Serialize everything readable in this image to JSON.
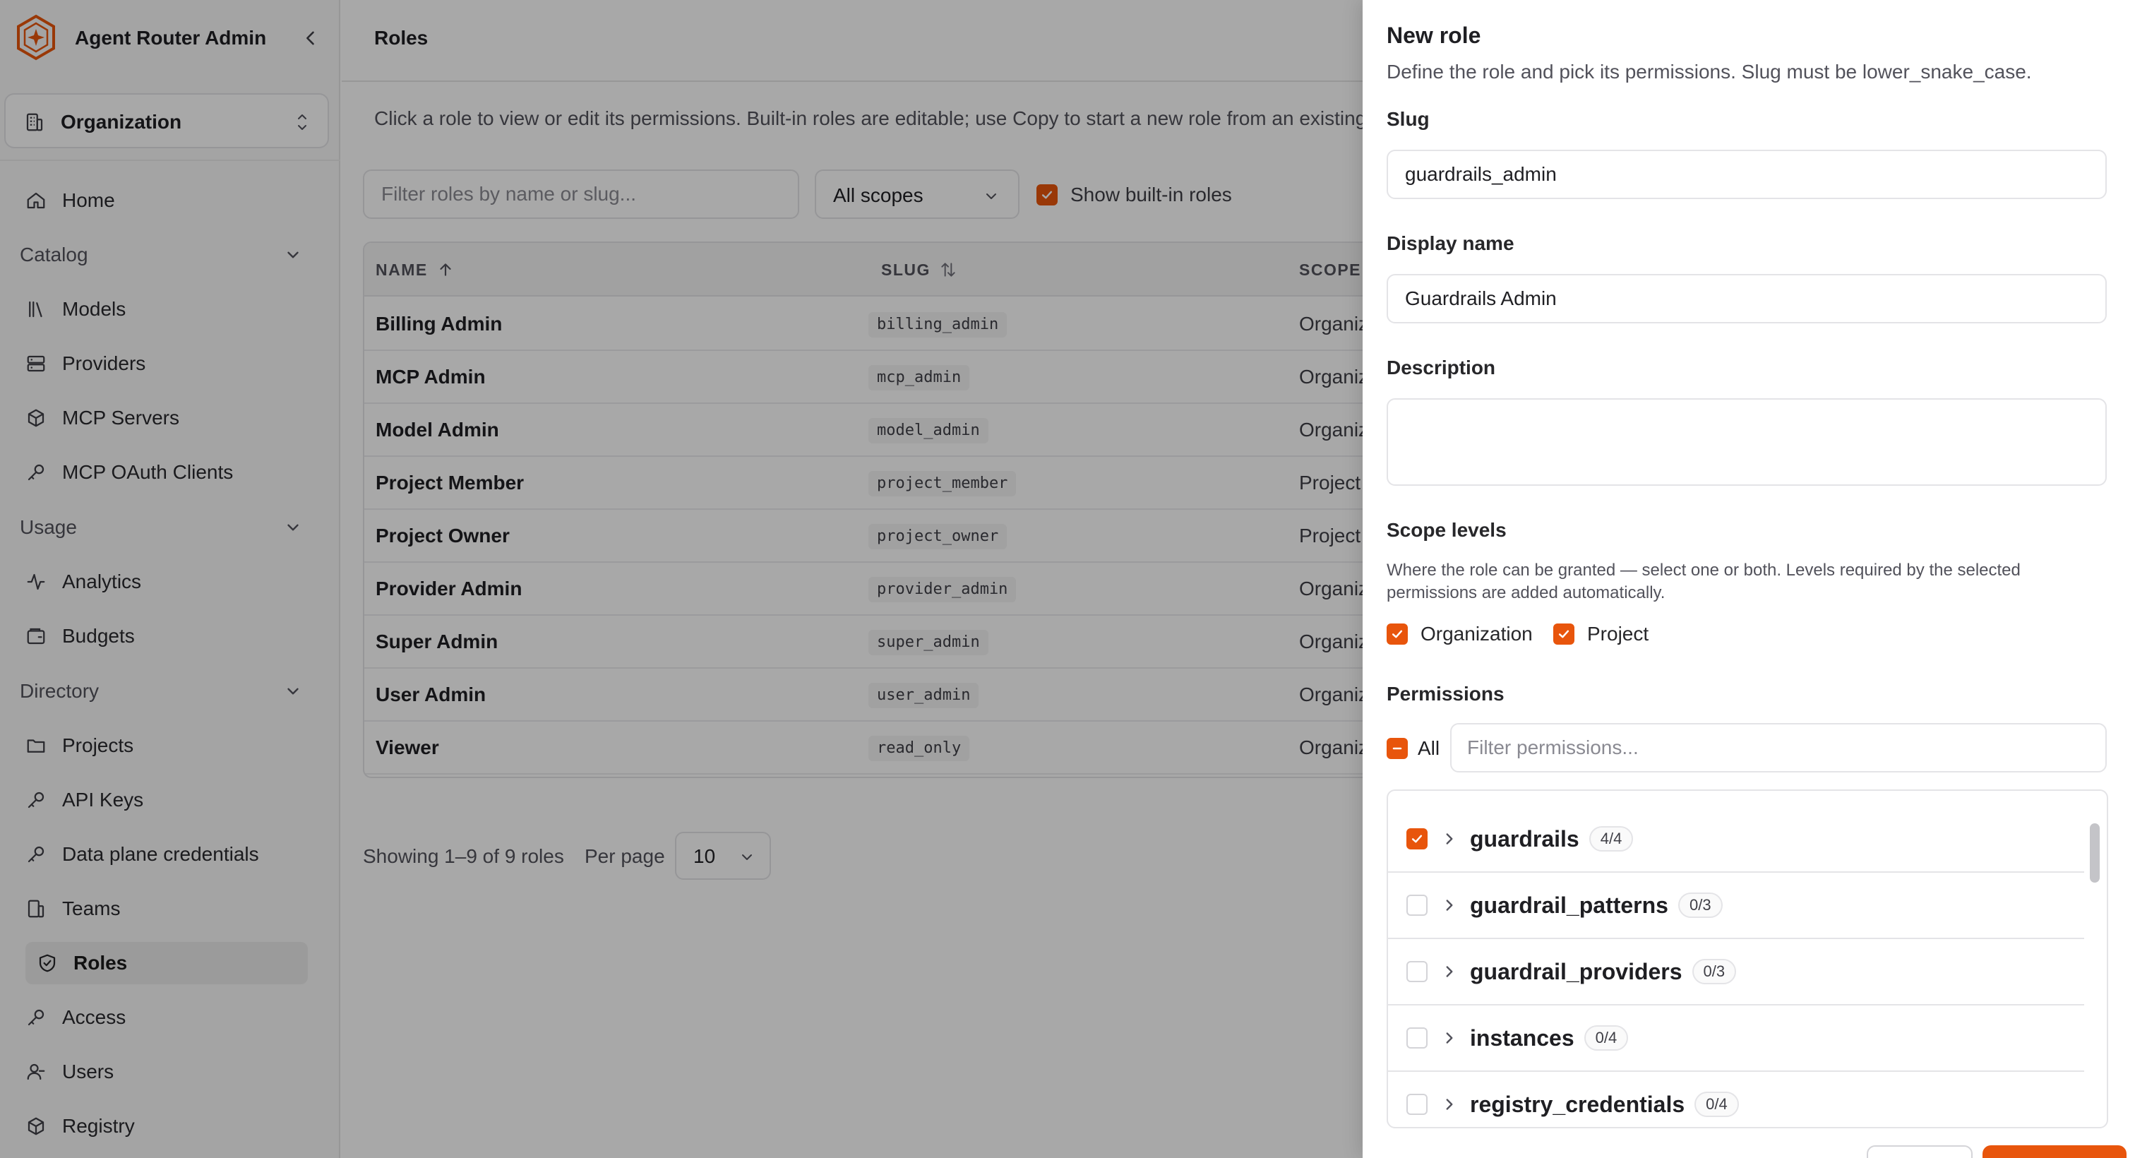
{
  "app": {
    "title": "Agent Router Admin"
  },
  "org_switcher": {
    "label": "Organization"
  },
  "nav": {
    "home": "Home",
    "groups": {
      "catalog": "Catalog",
      "usage": "Usage",
      "directory": "Directory"
    },
    "catalog_items": [
      "Models",
      "Providers",
      "MCP Servers",
      "MCP OAuth Clients"
    ],
    "usage_items": [
      "Analytics",
      "Budgets"
    ],
    "directory_items": [
      "Projects",
      "API Keys",
      "Data plane credentials",
      "Teams",
      "Roles",
      "Access",
      "Users",
      "Registry"
    ],
    "active": "Roles"
  },
  "page": {
    "title": "Roles",
    "intro": "Click a role to view or edit its permissions. Built-in roles are editable; use Copy to start a new role from an existing"
  },
  "filters": {
    "search_placeholder": "Filter roles by name or slug...",
    "scope_value": "All scopes",
    "show_builtin_label": "Show built-in roles",
    "show_builtin_checked": true
  },
  "table": {
    "columns": {
      "name": "NAME",
      "slug": "SLUG",
      "scope": "SCOPE"
    },
    "rows": [
      {
        "name": "Billing Admin",
        "slug": "billing_admin",
        "scope": "Organiz"
      },
      {
        "name": "MCP Admin",
        "slug": "mcp_admin",
        "scope": "Organiz"
      },
      {
        "name": "Model Admin",
        "slug": "model_admin",
        "scope": "Organiz"
      },
      {
        "name": "Project Member",
        "slug": "project_member",
        "scope": "Project"
      },
      {
        "name": "Project Owner",
        "slug": "project_owner",
        "scope": "Project"
      },
      {
        "name": "Provider Admin",
        "slug": "provider_admin",
        "scope": "Organiz"
      },
      {
        "name": "Super Admin",
        "slug": "super_admin",
        "scope": "Organiz"
      },
      {
        "name": "User Admin",
        "slug": "user_admin",
        "scope": "Organiz"
      },
      {
        "name": "Viewer",
        "slug": "read_only",
        "scope": "Organiz"
      }
    ]
  },
  "pagination": {
    "summary": "Showing 1–9 of 9 roles",
    "per_page_label": "Per page",
    "per_page_value": "10"
  },
  "drawer": {
    "title": "New role",
    "subtitle": "Define the role and pick its permissions. Slug must be lower_snake_case.",
    "slug_label": "Slug",
    "slug_value": "guardrails_admin",
    "display_name_label": "Display name",
    "display_name_value": "Guardrails Admin",
    "description_label": "Description",
    "description_value": "",
    "scope_levels_label": "Scope levels",
    "scope_levels_help": "Where the role can be granted — select one or both. Levels required by the selected permissions are added automatically.",
    "scope_options": [
      {
        "label": "Organization",
        "checked": true
      },
      {
        "label": "Project",
        "checked": true
      }
    ],
    "permissions_label": "Permissions",
    "all_label": "All",
    "permissions_filter_placeholder": "Filter permissions...",
    "permissions": [
      {
        "name": "guardrails",
        "count": "4/4",
        "checked": true
      },
      {
        "name": "guardrail_patterns",
        "count": "0/3",
        "checked": false
      },
      {
        "name": "guardrail_providers",
        "count": "0/3",
        "checked": false
      },
      {
        "name": "instances",
        "count": "0/4",
        "checked": false
      },
      {
        "name": "registry_credentials",
        "count": "0/4",
        "checked": false
      }
    ]
  },
  "colors": {
    "accent": "#e8550c",
    "sidebar_bg": "#f9f9f9",
    "border": "#e4e4e7"
  },
  "icons": {
    "brand": "hexagon-logo-icon",
    "collapse": "chevron-left-icon",
    "org": "building-icon",
    "updown": "chevrons-up-down-icon"
  }
}
